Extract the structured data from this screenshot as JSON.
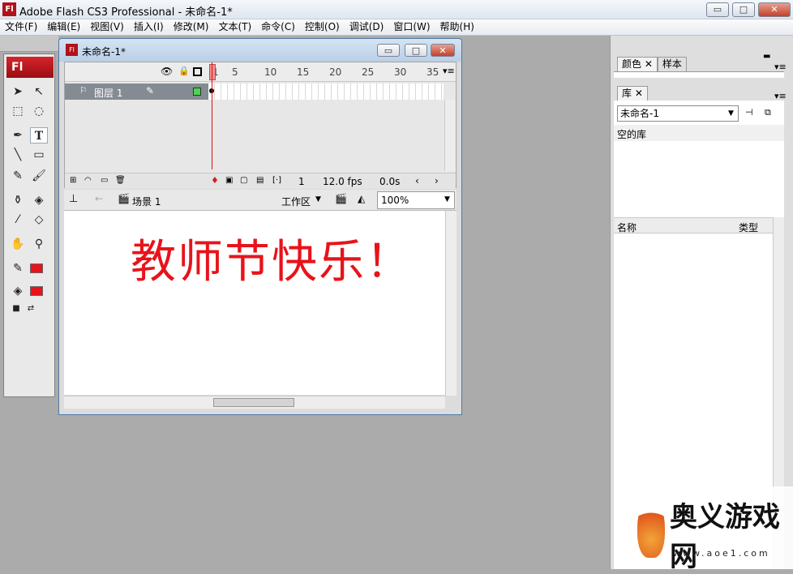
{
  "app": {
    "logo": "Fl",
    "title": "Adobe Flash CS3 Professional - 未命名-1*",
    "window_controls": [
      "▭",
      "□",
      "✕"
    ]
  },
  "menu": [
    "文件(F)",
    "编辑(E)",
    "视图(V)",
    "插入(I)",
    "修改(M)",
    "文本(T)",
    "命令(C)",
    "控制(O)",
    "调试(D)",
    "窗口(W)",
    "帮助(H)"
  ],
  "tools": {
    "logo": "Fl"
  },
  "document": {
    "title": "未命名-1*",
    "timeline": {
      "frame_numbers": [
        "1",
        "5",
        "10",
        "15",
        "20",
        "25",
        "30",
        "35"
      ],
      "layer_name": "图层 1",
      "status_frame": "1",
      "status_fps": "12.0 fps",
      "status_time": "0.0s"
    },
    "editbar": {
      "scene": "场景 1",
      "workspace": "工作区",
      "zoom": "100%"
    },
    "stage_text": "教师节快乐！"
  },
  "right_panel": {
    "tabs_top": [
      "颜色",
      "样本"
    ],
    "library_tab": "库",
    "library_doc": "未命名-1",
    "empty_label": "空的库",
    "col_name": "名称",
    "col_type": "类型"
  },
  "watermark": {
    "text": "奥义游戏网",
    "url": "www.aoe1.com"
  },
  "colors": {
    "accent": "#e8131a",
    "layer_row": "#848b93",
    "stage": "#ffffff"
  }
}
